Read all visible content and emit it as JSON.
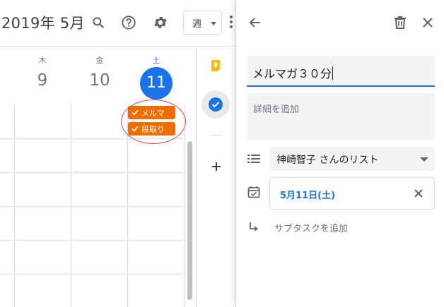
{
  "header": {
    "month_title": "2019年 5月",
    "view_label": "週",
    "icons": [
      "search-icon",
      "help-icon",
      "settings-icon",
      "more-vert-icon"
    ]
  },
  "days": [
    {
      "name": "木",
      "number": "9",
      "today": false
    },
    {
      "name": "金",
      "number": "10",
      "today": false
    },
    {
      "name": "土",
      "number": "11",
      "today": true
    }
  ],
  "chips": [
    {
      "label": "メルマ",
      "color": "#ef6c00"
    },
    {
      "label": "段取り",
      "color": "#ef6c00"
    }
  ],
  "rail": {
    "icons": [
      "keep-icon",
      "tasks-icon",
      "add-icon"
    ]
  },
  "panel": {
    "title_value": "メルマガ３０分",
    "details_placeholder": "詳細を追加",
    "list_name": "神崎智子 さんのリスト",
    "date": "5月11日(土)",
    "subtask_label": "サブタスクを追加"
  },
  "colors": {
    "accent": "#1a73e8",
    "task_chip": "#ef6c00",
    "annotation_circle": "#e8453c"
  }
}
